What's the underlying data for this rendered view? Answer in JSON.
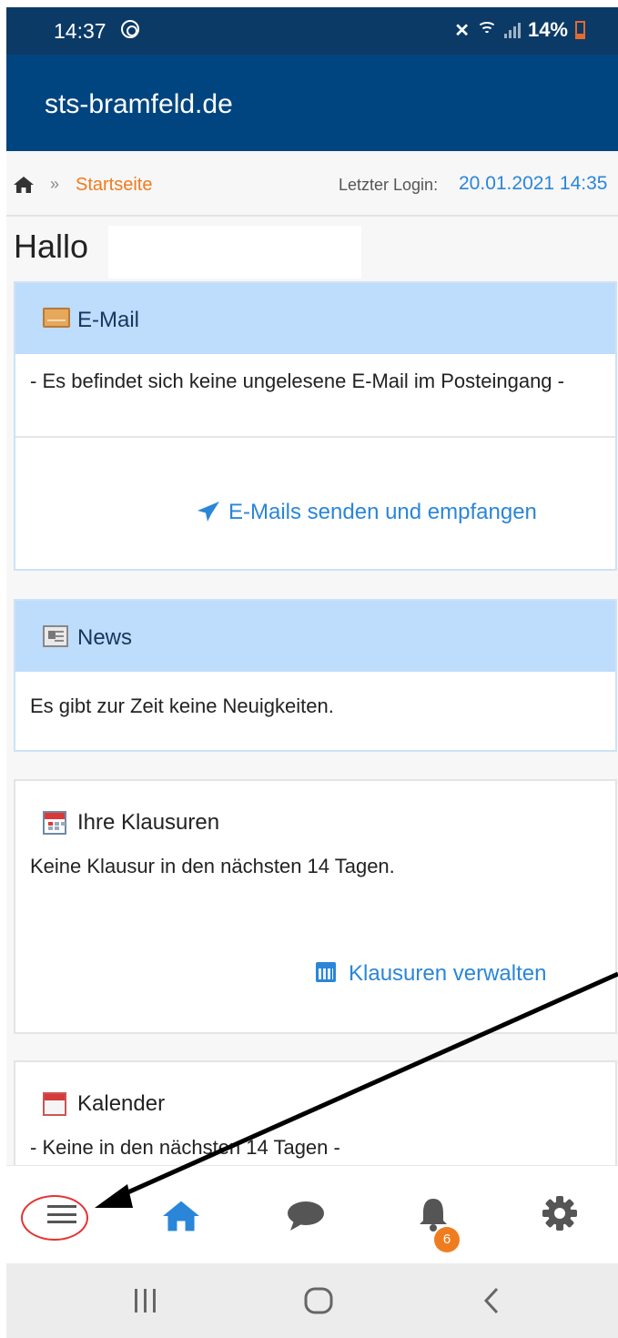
{
  "status_bar": {
    "time": "14:37",
    "battery": "14%",
    "icons": [
      "at-sign-icon",
      "mute-icon",
      "wifi-icon",
      "signal-icon",
      "battery-icon"
    ]
  },
  "app": {
    "title": "sts-bramfeld.de"
  },
  "breadcrumb": {
    "separator": "»",
    "current": "Startseite",
    "last_login_label": "Letzter Login:",
    "last_login_value": "20.01.2021 14:35"
  },
  "greeting": "Hallo",
  "panels": {
    "email": {
      "title": "E-Mail",
      "text": "- Es befindet sich keine ungelesene E-Mail im Posteingang -",
      "link": "E-Mails senden und empfangen"
    },
    "news": {
      "title": "News",
      "text": "Es gibt zur Zeit keine Neuigkeiten."
    },
    "exams": {
      "title": "Ihre Klausuren",
      "text": "Keine Klausur in den nächsten 14 Tagen.",
      "link": "Klausuren verwalten"
    },
    "calendar": {
      "title": "Kalender",
      "text": "- Keine in den nächsten 14 Tagen -"
    }
  },
  "bottom_nav": {
    "items": [
      "menu-icon",
      "home-icon",
      "chat-icon",
      "bell-icon",
      "gear-icon"
    ],
    "notification_count": "6"
  },
  "colors": {
    "status_bar": "#0c3a66",
    "header": "#004580",
    "panel_header": "#bedcfb",
    "link": "#2a86d8",
    "breadcrumb_active": "#f07b1d",
    "badge": "#ef7d1f",
    "annotation_circle": "#e53333"
  }
}
